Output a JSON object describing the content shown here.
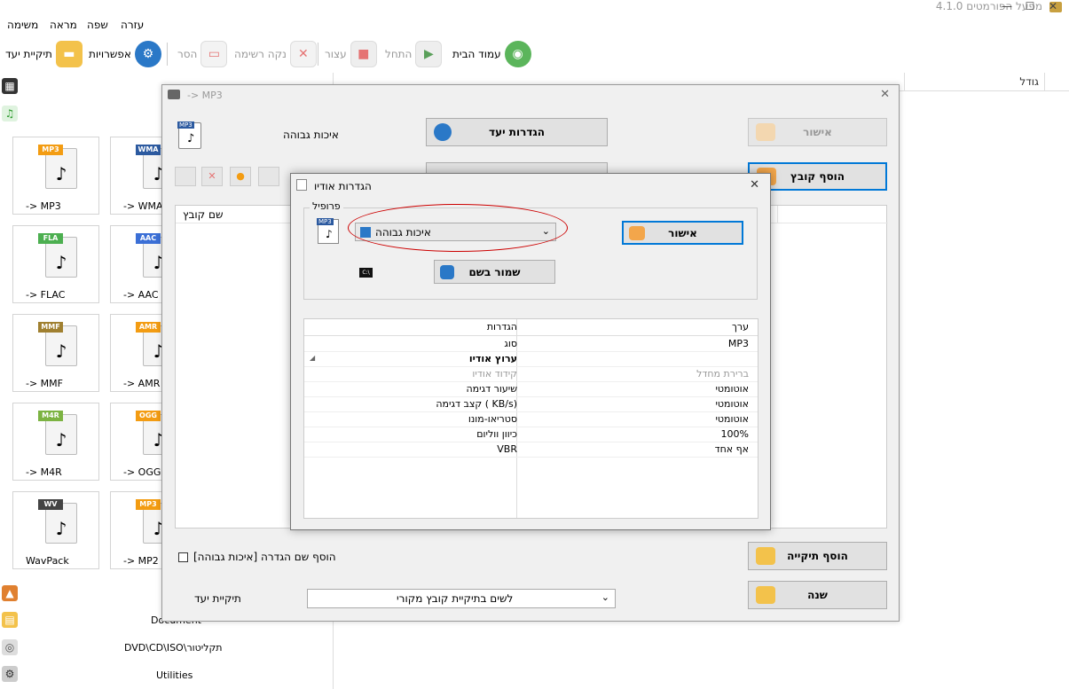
{
  "window": {
    "title": "4.1.0 מפעל הפורמטים",
    "minimize": "—",
    "maximize": "☐",
    "close": "✕"
  },
  "menu": {
    "items": [
      "משימה",
      "מראה",
      "שפה",
      "עזרה"
    ]
  },
  "toolbar": {
    "target_folder": "תיקיית יעד",
    "options": "אפשרויות",
    "remove": "הסר",
    "clear_list": "נקה רשימה",
    "stop": "עצור",
    "start": "התחל",
    "homepage": "עמוד הבית"
  },
  "main_list": {
    "headers": [
      "גודל"
    ]
  },
  "side": {
    "tiles": [
      {
        "name": "-> MP3",
        "tag": "MP3",
        "tag_color": "#f39c12"
      },
      {
        "name": "-> WMA",
        "tag": "WMA",
        "tag_color": "#2c5aa0"
      },
      {
        "name": "-> FLAC",
        "tag": "FLA",
        "tag_color": "#4caf50"
      },
      {
        "name": "-> AAC",
        "tag": "AAC",
        "tag_color": "#3b6fd6"
      },
      {
        "name": "-> MMF",
        "tag": "MMF",
        "tag_color": "#a08030"
      },
      {
        "name": "-> AMR",
        "tag": "AMR",
        "tag_color": "#f39c12"
      },
      {
        "name": "-> M4R",
        "tag": "M4R",
        "tag_color": "#7cb342"
      },
      {
        "name": "-> OGG",
        "tag": "OGG",
        "tag_color": "#f39c12"
      },
      {
        "name": "WavPack",
        "tag": "WV",
        "tag_color": "#444444"
      },
      {
        "name": "-> MP2",
        "tag": "MP3",
        "tag_color": "#f39c12"
      }
    ],
    "categories": {
      "document": "Document",
      "rom": "DVD\\CD\\ISO\\תקליטור",
      "utilities": "Utilities"
    }
  },
  "conversion": {
    "title": "-> MP3",
    "quality_label": "איכות גבוהה",
    "output_settings": "הגדרות יעד",
    "ok": "אישור",
    "add_file": "הוסף קובץ",
    "file_name_header": "שם קובץ",
    "add_folder": "הוסף תיקייה",
    "change": "שנה",
    "append_setting_label": "הוסף שם הגדרה [איכות גבוהה]",
    "dest_folder_label": "תיקיית יעד",
    "dest_folder_value": "לשים בתיקיית קובץ מקורי"
  },
  "audio": {
    "title": "הגדרות אודיו",
    "profile_label": "פרופיל",
    "profile_value": "איכות גבוהה",
    "ok": "אישור",
    "save_as": "שמור בשם",
    "col_settings": "הגדרות",
    "col_value": "ערך",
    "rows": [
      {
        "k": "סוג",
        "v": "MP3",
        "dim": false,
        "bold": false
      },
      {
        "k": "ערוץ אודיו",
        "v": "",
        "dim": false,
        "bold": true
      },
      {
        "k": "קידוד אודיו",
        "v": "ברירת מחדל",
        "dim": true,
        "bold": false
      },
      {
        "k": "שיעור דגימה",
        "v": "אוטומטי",
        "dim": false,
        "bold": false
      },
      {
        "k": "קצב דגימה ( KB/s)",
        "v": "אוטומטי",
        "dim": false,
        "bold": false
      },
      {
        "k": "סטריאו-מונו",
        "v": "אוטומטי",
        "dim": false,
        "bold": false
      },
      {
        "k": "כיוון ווליום",
        "v": "100%",
        "dim": false,
        "bold": false
      },
      {
        "k": "VBR",
        "v": "אף אחד",
        "dim": false,
        "bold": false
      }
    ]
  }
}
